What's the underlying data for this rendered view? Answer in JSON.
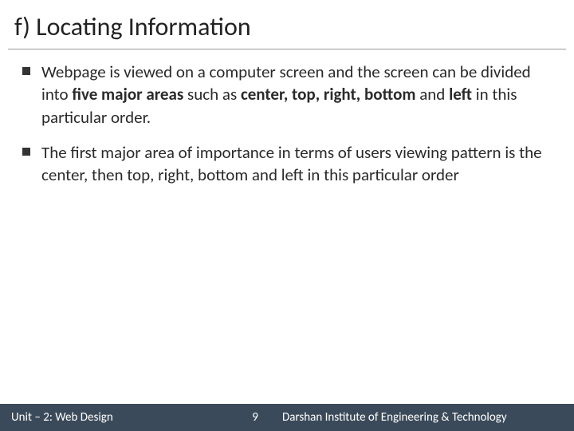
{
  "title": "f) Locating Information",
  "bullets": [
    {
      "pre": "Webpage is viewed on a computer screen and the screen can be divided into ",
      "bold1": "five major areas",
      "mid": " such as ",
      "bold2": "center, top, right, bottom",
      "mid2": " and ",
      "bold3": "left",
      "post": " in this particular order."
    },
    {
      "pre": "The first major area of importance in terms of users viewing pattern is the center, then top, right, bottom and left in this particular order",
      "bold1": "",
      "mid": "",
      "bold2": "",
      "mid2": "",
      "bold3": "",
      "post": ""
    }
  ],
  "footer": {
    "left": "Unit – 2: Web Design",
    "page": "9",
    "right": "Darshan Institute of Engineering & Technology"
  }
}
